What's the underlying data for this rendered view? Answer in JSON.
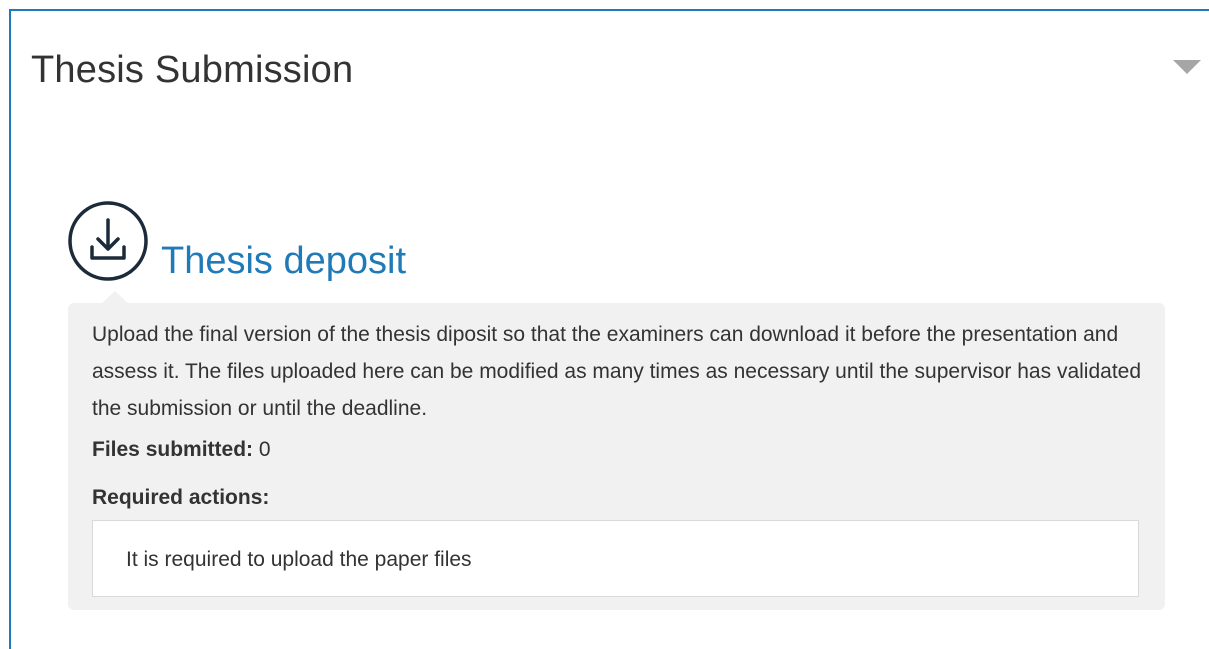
{
  "panel": {
    "title": "Thesis Submission",
    "collapse_icon": "triangle-down-icon"
  },
  "section": {
    "icon": "download-icon",
    "title": "Thesis deposit",
    "description": "Upload the final version of the thesis diposit so that the examiners can download it before the presentation and assess it. The files uploaded here can be modified as many times as necessary until the supervisor has validated the submission or until the deadline.",
    "files_submitted_label": "Files submitted:",
    "files_submitted_value": "0",
    "required_actions_label": "Required actions:",
    "required_actions": [
      "It is required to upload the paper files"
    ]
  },
  "colors": {
    "accent": "#1f7ab8",
    "card_background": "#f1f1f1",
    "text": "#333333"
  }
}
